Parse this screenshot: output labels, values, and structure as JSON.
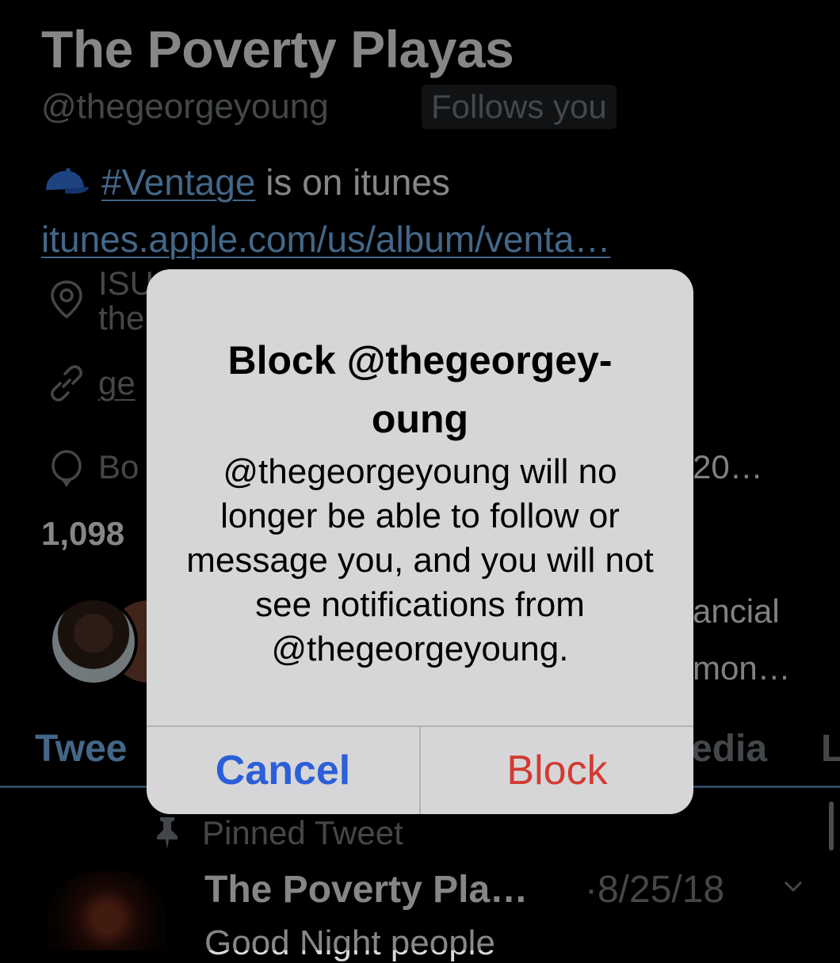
{
  "profile": {
    "name": "The Poverty Playas",
    "handle": "@thegeorgeyoung",
    "follows_badge": "Follows you",
    "bio_hashtag": "#Ventage",
    "bio_text": " is on itunes",
    "bio_url": "itunes.apple.com/us/album/venta…",
    "location_partial_1": "ISU",
    "location_partial_2": "the",
    "website_partial": "ge",
    "born_partial": "Bo",
    "born_suffix": "20…",
    "stat_partial": "1,098",
    "followers_known_suffix_1": "ancial",
    "followers_known_suffix_2": "mon…"
  },
  "tabs": {
    "tweets": "Twee",
    "media": "edia",
    "likes": "L"
  },
  "tweet": {
    "pinned_label": "Pinned Tweet",
    "author": "The Poverty Pla…",
    "date": "·8/25/18",
    "text": "Good Night people"
  },
  "dialog": {
    "title": "Block @thegeorgey-oung",
    "title_line1": "Block @thegeorgey-",
    "title_line2": "oung",
    "message": "@thegeorgeyoung will no longer be able to follow or message you, and you will not see notifications from @thegeorgeyoung.",
    "cancel_label": "Cancel",
    "block_label": "Block"
  },
  "colors": {
    "background": "#000000",
    "link": "#6da7dc",
    "dialog_bg": "#d6d6d8",
    "cancel": "#2b5fd9",
    "block": "#d33a32"
  }
}
